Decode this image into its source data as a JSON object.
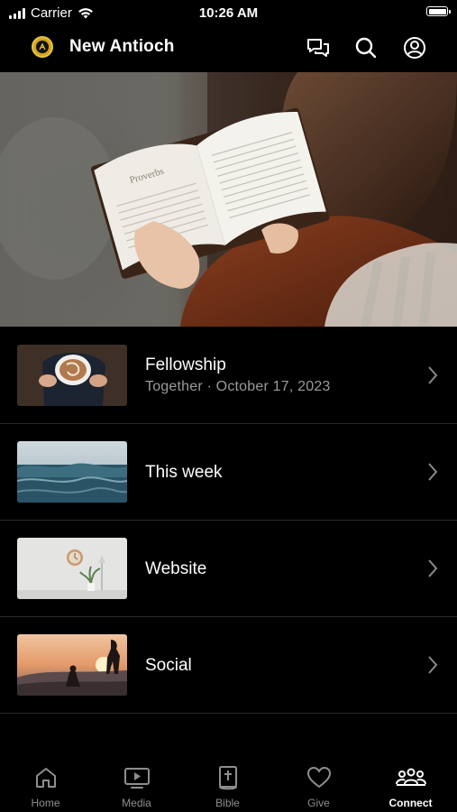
{
  "status_bar": {
    "carrier": "Carrier",
    "time": "10:26 AM"
  },
  "header": {
    "title": "New Antioch",
    "icons": [
      "chat-icon",
      "search-icon",
      "profile-icon"
    ]
  },
  "hero": {
    "image": "woman-reading-bible-photo"
  },
  "items": [
    {
      "title": "Fellowship",
      "subtitle": "Together · October 17, 2023",
      "thumbnail": "coffee-cup-photo"
    },
    {
      "title": "This week",
      "subtitle": "",
      "thumbnail": "ocean-waves-photo"
    },
    {
      "title": "Website",
      "subtitle": "",
      "thumbnail": "clock-and-plant-photo"
    },
    {
      "title": "Social",
      "subtitle": "",
      "thumbnail": "sunset-people-photo"
    }
  ],
  "tabs": [
    {
      "label": "Home",
      "icon": "house-icon",
      "active": false
    },
    {
      "label": "Media",
      "icon": "tv-play-icon",
      "active": false
    },
    {
      "label": "Bible",
      "icon": "bible-icon",
      "active": false
    },
    {
      "label": "Give",
      "icon": "heart-icon",
      "active": false
    },
    {
      "label": "Connect",
      "icon": "people-icon",
      "active": true
    }
  ],
  "colors": {
    "background": "#000000",
    "text": "#ffffff",
    "secondary_text": "#9a9a9a",
    "inactive_tab": "#8e8e8e",
    "divider": "#2a2a2a"
  }
}
